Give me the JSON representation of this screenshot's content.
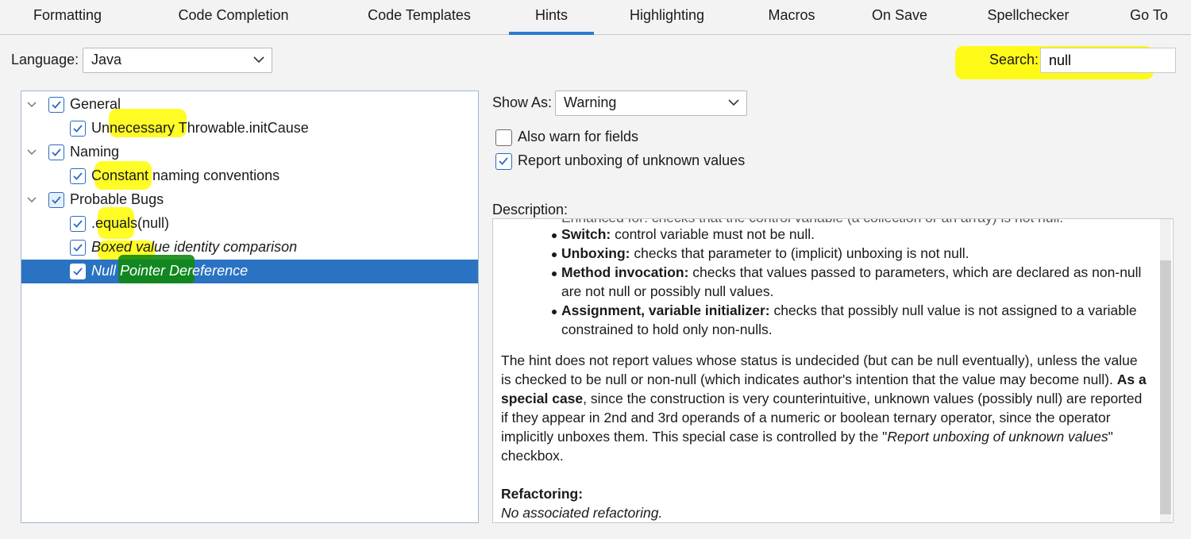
{
  "tabs": [
    {
      "label": "Formatting"
    },
    {
      "label": "Code Completion"
    },
    {
      "label": "Code Templates"
    },
    {
      "label": "Hints"
    },
    {
      "label": "Highlighting"
    },
    {
      "label": "Macros"
    },
    {
      "label": "On Save"
    },
    {
      "label": "Spellchecker"
    },
    {
      "label": "Go To"
    }
  ],
  "active_tab": "Hints",
  "language": {
    "label": "Language:",
    "value": "Java"
  },
  "search": {
    "label": "Search:",
    "value": "null"
  },
  "tree": {
    "items": [
      {
        "label": "General",
        "checked": true,
        "expanded": true
      },
      {
        "label": "Unnecessary Throwable.initCause",
        "checked": true
      },
      {
        "label": "Naming",
        "checked": true,
        "expanded": true
      },
      {
        "label": "Constant naming conventions",
        "checked": true
      },
      {
        "label": "Probable Bugs",
        "checked": true,
        "expanded": true
      },
      {
        "label": ".equals(null)",
        "checked": true
      },
      {
        "label": "Boxed value identity comparison",
        "checked": true
      },
      {
        "label": "Null Pointer Dereference",
        "checked": true,
        "selected": true
      }
    ]
  },
  "show_as": {
    "label": "Show As:",
    "value": "Warning"
  },
  "options": [
    {
      "label": "Also warn for fields",
      "checked": false
    },
    {
      "label": "Report unboxing of unknown values",
      "checked": true
    }
  ],
  "description": {
    "label": "Description:",
    "cut_line": "Enhanced for: checks that the control variable (a collection or an array) is not null.",
    "bullets": [
      {
        "term": "Switch:",
        "text": " control variable must not be null."
      },
      {
        "term": "Unboxing:",
        "text": " checks that parameter to (implicit) unboxing is not null."
      },
      {
        "term": "Method invocation:",
        "text": " checks that values passed to parameters, which are declared as non-null are not null or possibly null values."
      },
      {
        "term": "Assignment, variable initializer:",
        "text": " checks that possibly null value is not assigned to a variable constrained to hold only non-nulls."
      }
    ],
    "para_1": "The hint does not report values whose status is undecided (but can be null eventually), unless the value is checked to be null or non-null (which indicates author's intention that the value may become null). ",
    "para_bold": "As a special case",
    "para_2": ", since the construction is very counterintuitive, unknown values (possibly null) are reported if they appear in 2nd and 3rd operands of a numeric or boolean ternary operator, since the operator implicitly unboxes them. This special case is controlled by the \"",
    "para_italic": "Report unboxing of unknown values",
    "para_3": "\" checkbox.",
    "refactoring_heading": "Refactoring:",
    "refactoring_value": "No associated refactoring."
  },
  "colors": {
    "accent": "#2a7bd0",
    "selection": "#2a73c2",
    "highlight": "#fffb00",
    "highlight_selected": "#0f8a0f"
  }
}
